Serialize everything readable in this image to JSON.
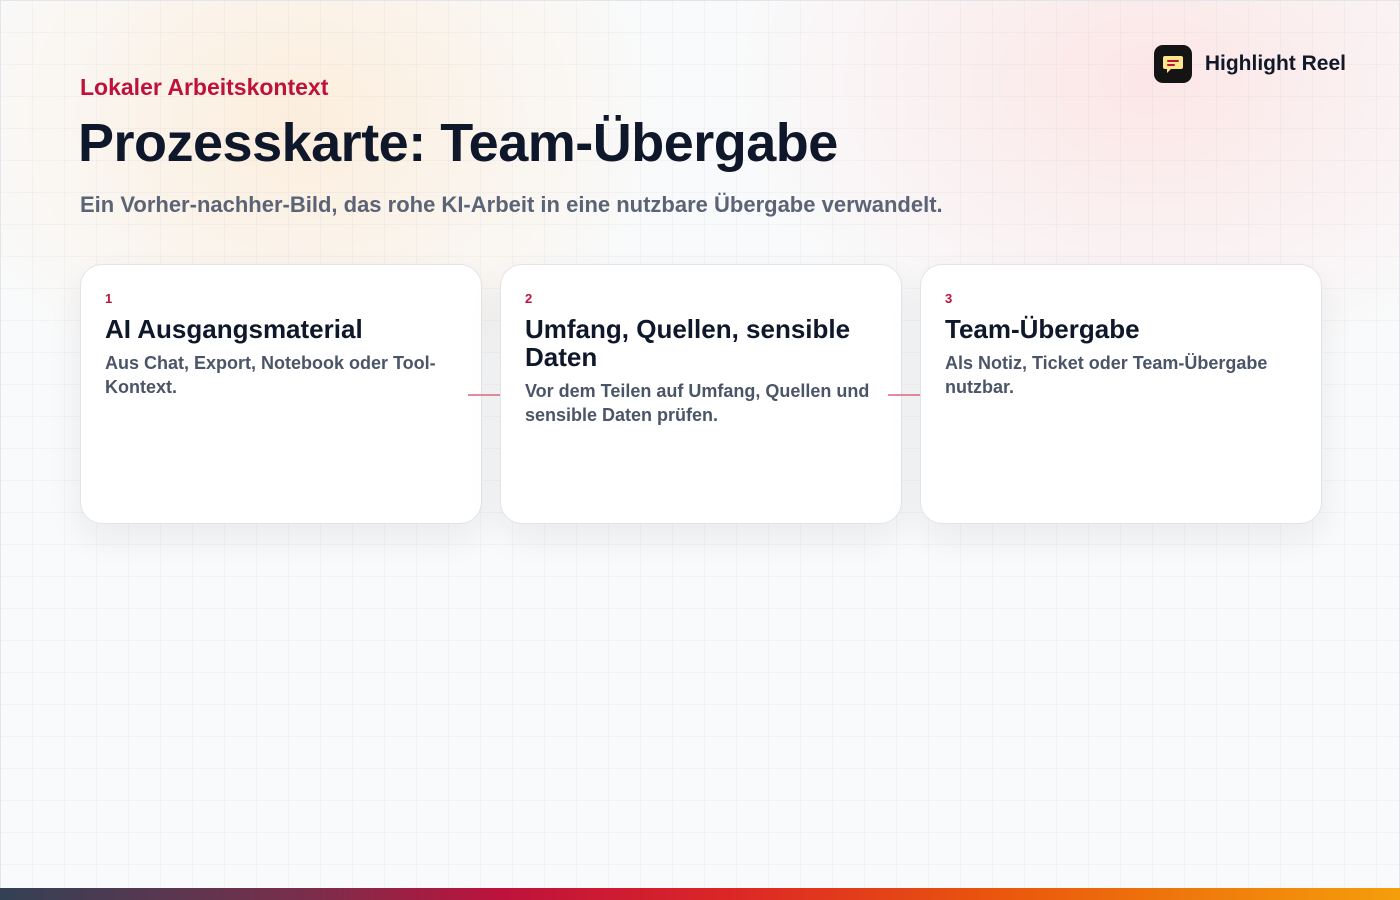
{
  "header": {
    "kicker": "Lokaler Arbeitskontext",
    "title": "Prozesskarte: Team-Übergabe",
    "subtitle": "Ein Vorher-nachher-Bild, das rohe KI-Arbeit in eine nutzbare Übergabe verwandelt."
  },
  "brand": {
    "name": "Highlight Reel",
    "icon": "speech-bubble-icon"
  },
  "steps": [
    {
      "number": "1",
      "title": "AI Ausgangsmaterial",
      "description": "Aus Chat, Export, Notebook oder Tool-Kontext."
    },
    {
      "number": "2",
      "title": "Umfang, Quellen, sensible Daten",
      "description": "Vor dem Teilen auf Umfang, Quellen und sensible Daten prüfen."
    },
    {
      "number": "3",
      "title": "Team-Übergabe",
      "description": "Als Notiz, Ticket oder Team-Übergabe nutzbar."
    }
  ],
  "colors": {
    "accent": "#be123c",
    "title": "#0f172a",
    "muted": "#5b6476"
  }
}
